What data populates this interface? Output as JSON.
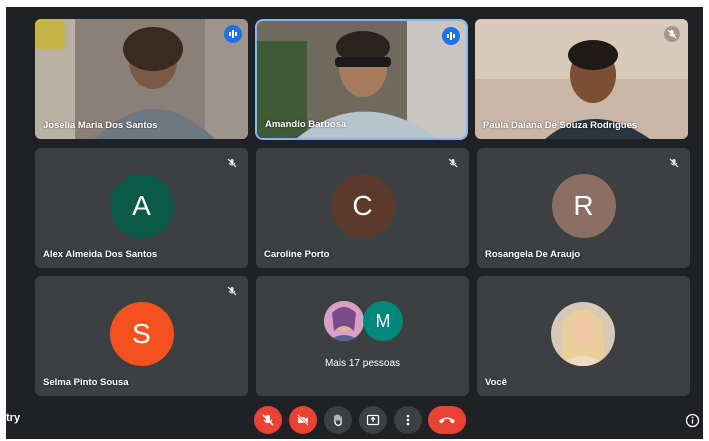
{
  "participants": [
    {
      "name": "Joselia Maria Dos Santos",
      "state": "speaking"
    },
    {
      "name": "Amandio Barbosa",
      "state": "speaking"
    },
    {
      "name": "Paula Daiana De Souza Rodrigues",
      "state": "muted"
    },
    {
      "name": "Alex Almeida Dos Santos",
      "initial": "A",
      "color": "#0b5a46"
    },
    {
      "name": "Caroline Porto",
      "initial": "C",
      "color": "#5b3a2c"
    },
    {
      "name": "Rosangela De Araujo",
      "initial": "R",
      "color": "#8d6e63"
    },
    {
      "name": "Selma Pinto Sousa",
      "initial": "S",
      "color": "#f4511e"
    },
    {
      "name": "Você"
    }
  ],
  "overflow": {
    "label": "Mais 17 pessoas",
    "initial": "M",
    "color": "#00897b"
  },
  "footer": {
    "left_text": "try"
  },
  "controls": [
    "mic-off",
    "camera-off",
    "raise-hand",
    "present-screen",
    "more-options",
    "leave-call"
  ],
  "accent": "#1a73e8",
  "danger": "#ea4335"
}
